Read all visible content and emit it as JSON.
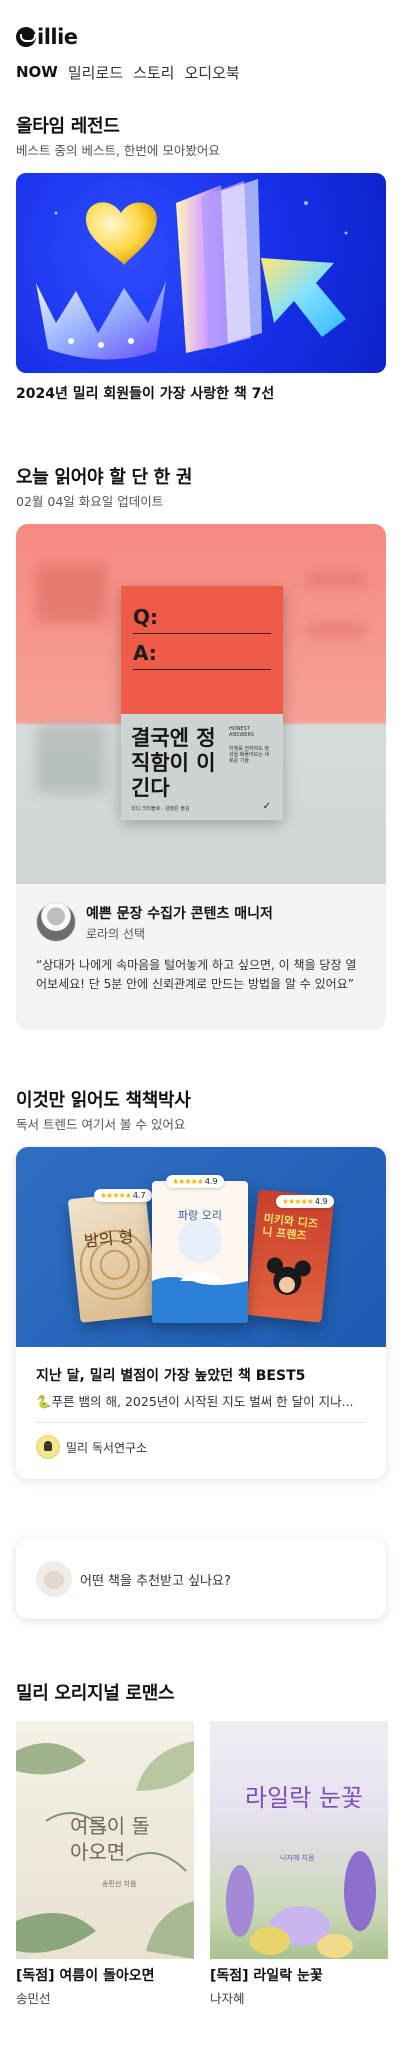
{
  "header": {
    "logo_text": "illie",
    "tabs": [
      {
        "label": "NOW",
        "active": true
      },
      {
        "label": "밀리로드",
        "active": false
      },
      {
        "label": "스토리",
        "active": false
      },
      {
        "label": "오디오북",
        "active": false
      }
    ]
  },
  "legend": {
    "title": "올타임 레전드",
    "subtitle": "베스트 중의 베스트, 한번에 모아봤어요",
    "caption": "2024년 밀리 회원들이 가장 사랑한 책 7선"
  },
  "daily": {
    "title": "오늘 읽어야 할 단 한 권",
    "subtitle": "02월 04일 화요일 업데이트",
    "book": {
      "q": "Q:",
      "a": "A:",
      "title": "결국엔 정직함이 이긴다",
      "tag": "HONEST ANSWERS",
      "desc": "지혜를 전하여도 정성을 배풀어보는 새로운 기술",
      "author": "코디 크리블로 · 강정은 옮김",
      "check": "✓"
    },
    "pick": {
      "name": "예쁜 문장 수집가 콘텐츠 매니저",
      "role": "로라의 선택",
      "quote": "“상대가 나에게 속마음을 털어놓게 하고 싶으면, 이 책을 당장 열어보세요! 단 5분 안에 신뢰관계로 만드는 방법을 알 수 있어요”"
    }
  },
  "must_read": {
    "title": "이것만 읽어도 책책박사",
    "subtitle": "독서 트렌드 여기서 볼 수 있어요",
    "books": [
      {
        "title": "밤의 형",
        "rating": "4.7"
      },
      {
        "title": "파랑 오리",
        "rating": "4.9"
      },
      {
        "title": "미키와 디즈니 프렌즈",
        "rating": "4.9"
      }
    ],
    "card_title": "지난 달, 밀리 별점이 가장 높았던 책 BEST5",
    "card_desc": "🐍푸른 뱀의 해, 2025년이 시작된 지도 벌써 한 달이 지나...",
    "org": "밀리 독서연구소"
  },
  "recommend": {
    "text": "어떤 책을 추천받고 싶나요?"
  },
  "romance": {
    "title": "밀리 오리지널 로맨스",
    "items": [
      {
        "cover_text": "여름이 돌아오면",
        "cover_author": "송민선 지음",
        "title": "[독점] 여름이 돌아오면",
        "author": "송민선"
      },
      {
        "cover_text": "라일락 눈꽃",
        "cover_author": "나자혜 지음",
        "title": "[독점] 라일락 눈꽃",
        "author": "나자혜"
      }
    ]
  },
  "icons": {
    "logo_mark": "millie-logo-icon",
    "org_icon": "reading-lab-icon",
    "bear_icon": "bear-mascot-icon"
  }
}
